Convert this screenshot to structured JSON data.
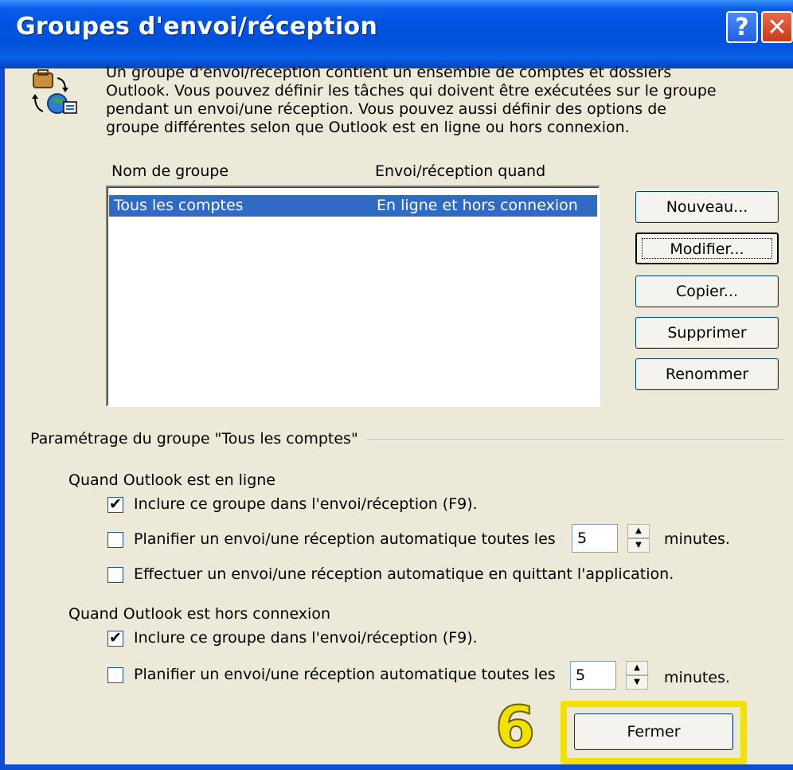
{
  "window": {
    "title": "Groupes d'envoi/réception"
  },
  "intro_text": "Un groupe d'envoi/réception contient un ensemble de comptes et dossiers\nOutlook. Vous pouvez définir les tâches qui doivent être exécutées sur le groupe\npendant un envoi/une réception. Vous pouvez aussi définir des options de\ngroupe différentes selon que Outlook est en ligne ou hors connexion.",
  "list": {
    "columns": [
      "Nom de groupe",
      "Envoi/réception quand"
    ],
    "rows": [
      {
        "name": "Tous les comptes",
        "when": "En ligne et hors connexion",
        "selected": true
      }
    ]
  },
  "buttons": {
    "nouveau": "Nouveau...",
    "modifier": "Modifier...",
    "copier": "Copier...",
    "supprimer": "Supprimer",
    "renommer": "Renommer",
    "fermer": "Fermer"
  },
  "group_settings": {
    "label": "Paramétrage du groupe \"Tous les comptes\"",
    "online": {
      "label": "Quand Outlook est en ligne",
      "include": {
        "label": "Inclure ce groupe dans l'envoi/réception (F9).",
        "checked": true
      },
      "schedule": {
        "label": "Planifier un envoi/une réception automatique toutes les",
        "checked": false,
        "minutes": "5",
        "unit": "minutes."
      },
      "on_exit": {
        "label": "Effectuer un envoi/une réception automatique en quittant l'application.",
        "checked": false
      }
    },
    "offline": {
      "label": "Quand Outlook est hors connexion",
      "include": {
        "label": "Inclure ce groupe dans l'envoi/réception (F9).",
        "checked": true
      },
      "schedule": {
        "label": "Planifier un envoi/une réception automatique toutes les",
        "checked": false,
        "minutes": "5",
        "unit": "minutes."
      }
    }
  },
  "annotation": {
    "step_number": "6",
    "color": "#f2e000"
  },
  "colors": {
    "titlebar": "#0054e3",
    "selection": "#316ac5",
    "dialog_bg": "#ece9d8"
  },
  "title_buttons": {
    "help": "?",
    "close": "✕"
  },
  "check_mark": "✔"
}
